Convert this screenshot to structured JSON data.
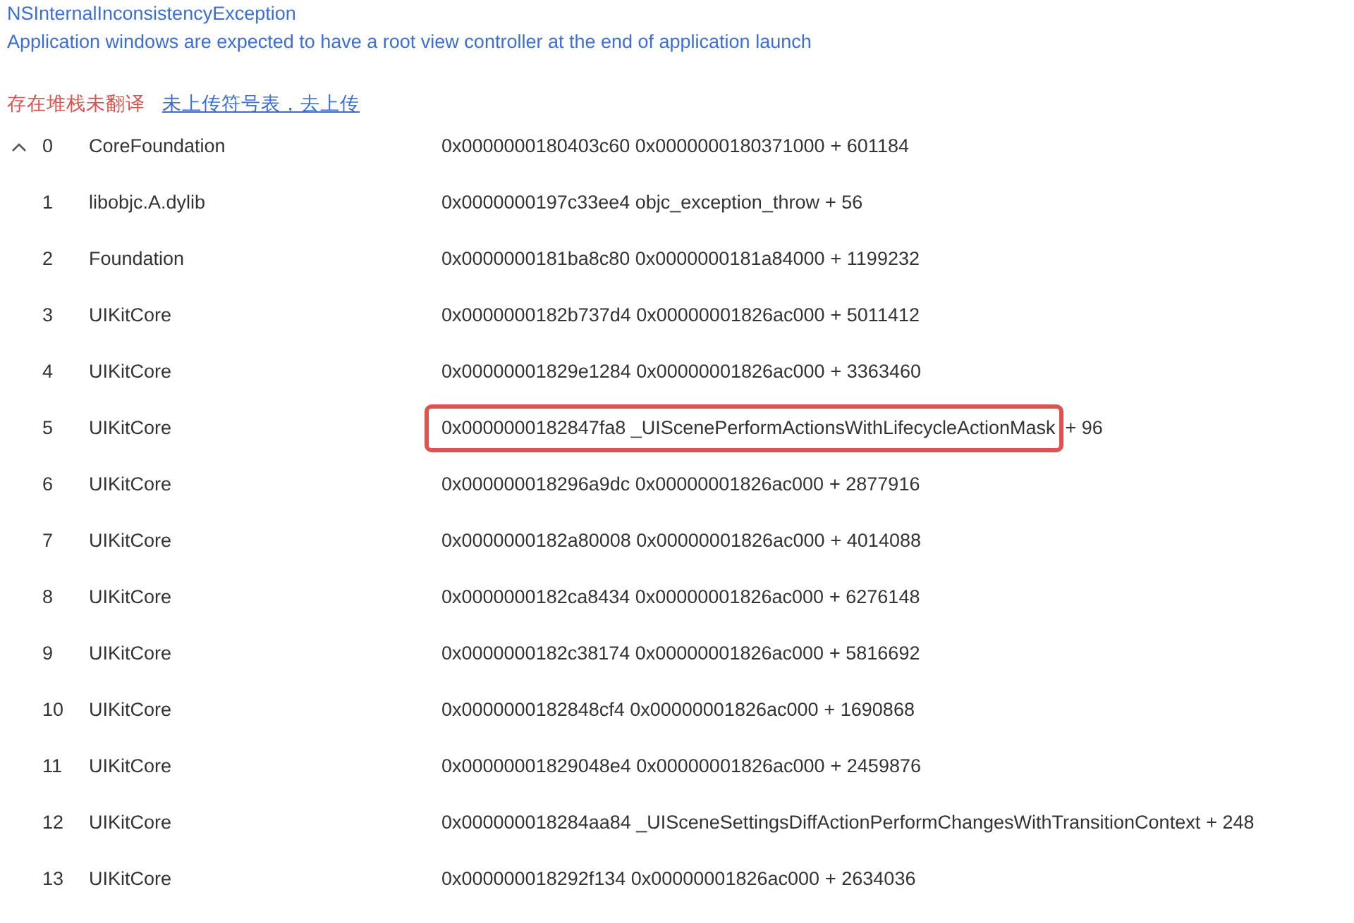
{
  "exception": {
    "name": "NSInternalInconsistencyException",
    "reason": "Application windows are expected to have a root view controller at the end of application launch"
  },
  "notice": {
    "warning": "存在堆栈未翻译",
    "link": "未上传符号表，去上传"
  },
  "frames": [
    {
      "index": "0",
      "module": "CoreFoundation",
      "symbol": "0x0000000180403c60 0x0000000180371000",
      "offset": "+ 601184",
      "highlighted": false,
      "expanded": true
    },
    {
      "index": "1",
      "module": "libobjc.A.dylib",
      "symbol": "0x0000000197c33ee4 objc_exception_throw",
      "offset": "+ 56",
      "highlighted": false
    },
    {
      "index": "2",
      "module": "Foundation",
      "symbol": "0x0000000181ba8c80 0x0000000181a84000",
      "offset": "+ 1199232",
      "highlighted": false
    },
    {
      "index": "3",
      "module": "UIKitCore",
      "symbol": "0x0000000182b737d4 0x00000001826ac000",
      "offset": "+ 5011412",
      "highlighted": false
    },
    {
      "index": "4",
      "module": "UIKitCore",
      "symbol": "0x00000001829e1284 0x00000001826ac000",
      "offset": "+ 3363460",
      "highlighted": false
    },
    {
      "index": "5",
      "module": "UIKitCore",
      "symbol": "0x0000000182847fa8 _UIScenePerformActionsWithLifecycleActionMask",
      "offset": "+ 96",
      "highlighted": true
    },
    {
      "index": "6",
      "module": "UIKitCore",
      "symbol": "0x000000018296a9dc 0x00000001826ac000",
      "offset": "+ 2877916",
      "highlighted": false
    },
    {
      "index": "7",
      "module": "UIKitCore",
      "symbol": "0x0000000182a80008 0x00000001826ac000",
      "offset": "+ 4014088",
      "highlighted": false
    },
    {
      "index": "8",
      "module": "UIKitCore",
      "symbol": "0x0000000182ca8434 0x00000001826ac000",
      "offset": "+ 6276148",
      "highlighted": false
    },
    {
      "index": "9",
      "module": "UIKitCore",
      "symbol": "0x0000000182c38174 0x00000001826ac000",
      "offset": "+ 5816692",
      "highlighted": false
    },
    {
      "index": "10",
      "module": "UIKitCore",
      "symbol": "0x0000000182848cf4 0x00000001826ac000",
      "offset": "+ 1690868",
      "highlighted": false
    },
    {
      "index": "11",
      "module": "UIKitCore",
      "symbol": "0x00000001829048e4 0x00000001826ac000",
      "offset": "+ 2459876",
      "highlighted": false
    },
    {
      "index": "12",
      "module": "UIKitCore",
      "symbol": "0x000000018284aa84 _UISceneSettingsDiffActionPerformChangesWithTransitionContext",
      "offset": "+ 248",
      "highlighted": false
    },
    {
      "index": "13",
      "module": "UIKitCore",
      "symbol": "0x000000018292f134 0x00000001826ac000",
      "offset": "+ 2634036",
      "highlighted": false
    }
  ]
}
